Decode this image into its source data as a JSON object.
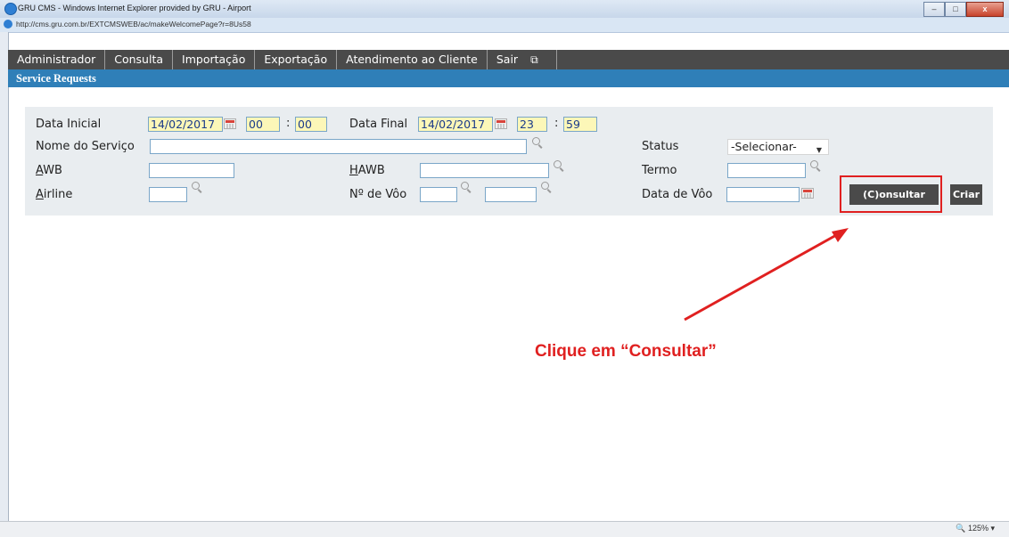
{
  "window": {
    "title": "GRU CMS - Windows Internet Explorer provided by GRU - Airport",
    "url": "http://cms.gru.com.br/EXTCMSWEB/ac/makeWelcomePage?r=8Us58",
    "buttons": {
      "minimize": "–",
      "maximize": "□",
      "close": "x"
    }
  },
  "menu": {
    "items": [
      "Administrador",
      "Consulta",
      "Importação",
      "Exportação",
      "Atendimento ao Cliente",
      "Sair"
    ],
    "restore_icon": "restore-window-icon"
  },
  "section_title": "Service Requests",
  "form": {
    "data_inicial_label": "Data Inicial",
    "data_inicial_value": "14/02/2017",
    "hora_inicial": "00",
    "minuto_inicial": "00",
    "data_final_label": "Data Final",
    "data_final_value": "14/02/2017",
    "hora_final": "23",
    "minuto_final": "59",
    "colon": ":",
    "nome_servico_label": "Nome do Serviço",
    "status_label": "Status",
    "status_value": "-Selecionar-",
    "awb_label_first": "A",
    "awb_label_rest": "WB",
    "hawb_label_first": "H",
    "hawb_label_rest": "AWB",
    "termo_label": "Termo",
    "airline_label_first": "A",
    "airline_label_rest": "irline",
    "voo_label": "Nº de Vôo",
    "data_voo_label": "Data de Vôo",
    "consultar_button": "(C)onsultar",
    "criar_button": "Criar"
  },
  "annotation": {
    "callout_text": "Clique em “Consultar”",
    "color": "#e02020"
  },
  "status": {
    "zoom": "125%"
  }
}
